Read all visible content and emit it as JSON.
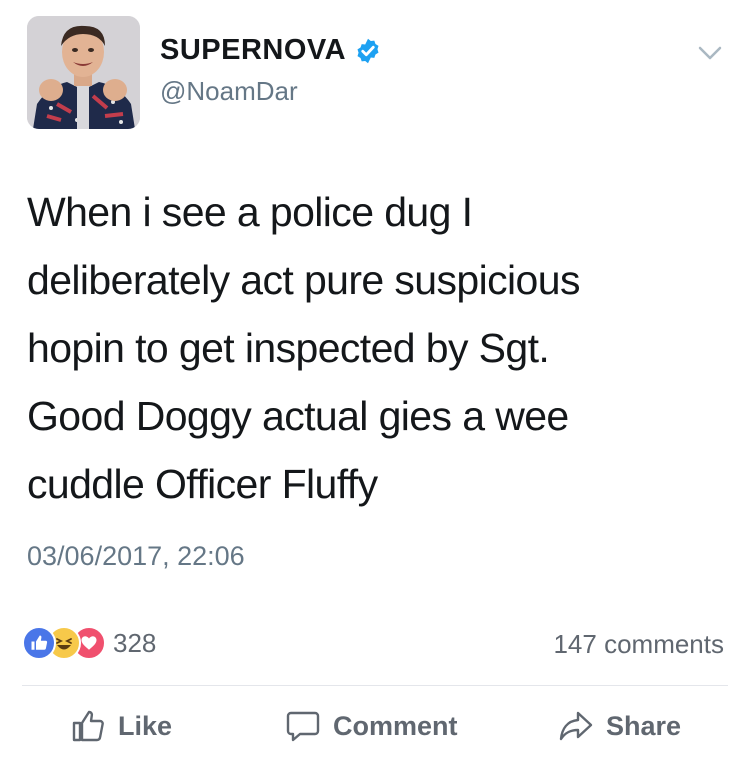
{
  "author": {
    "display_name": "SUPERNOVA",
    "handle": "@NoamDar",
    "verified": true,
    "avatar_icon": "profile-photo"
  },
  "post": {
    "text_lines": [
      "When i see a police dug I",
      "deliberately act pure suspicious",
      "hopin to get inspected by Sgt.",
      "Good Doggy actual gies a wee",
      "cuddle Officer Fluffy"
    ],
    "timestamp": "03/06/2017, 22:06"
  },
  "engagement": {
    "reaction_count": "328",
    "reaction_icons": [
      "like-reaction-icon",
      "haha-reaction-icon",
      "love-reaction-icon"
    ],
    "comments_label": "147 comments"
  },
  "actions": {
    "like_label": "Like",
    "comment_label": "Comment",
    "share_label": "Share"
  },
  "colors": {
    "verified_blue": "#1da1f2",
    "like_blue": "#4a76e8",
    "haha_yellow": "#f7c94a",
    "love_red": "#f0506e",
    "secondary_text": "#657786"
  }
}
